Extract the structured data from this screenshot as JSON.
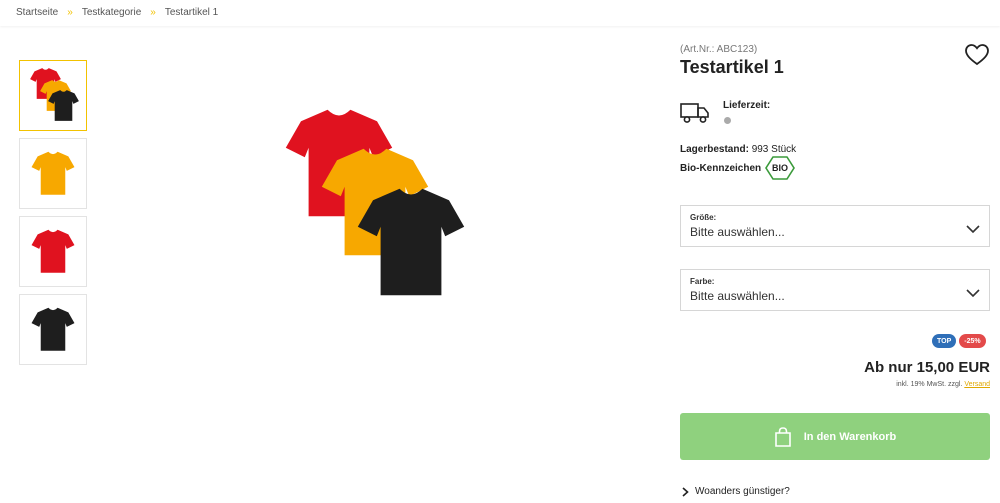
{
  "breadcrumb": {
    "items": [
      "Startseite",
      "Testkategorie",
      "Testartikel 1"
    ],
    "separator": "»"
  },
  "gallery": {
    "thumbnails": [
      "tshirt-set",
      "tshirt-yellow",
      "tshirt-red",
      "tshirt-black"
    ],
    "active_index": 0
  },
  "product": {
    "art_nr": "(Art.Nr.: ABC123)",
    "title": "Testartikel 1",
    "delivery_label": "Lieferzeit:",
    "stock_label": "Lagerbestand:",
    "stock_value": "993 Stück",
    "bio_label": "Bio-Kennzeichen",
    "bio_seal_text": "BIO"
  },
  "options": {
    "size": {
      "label": "Größe:",
      "placeholder": "Bitte auswählen..."
    },
    "color": {
      "label": "Farbe:",
      "placeholder": "Bitte auswählen..."
    }
  },
  "badges": {
    "top": "TOP",
    "sale": "-25%"
  },
  "pricing": {
    "price": "Ab nur 15,00 EUR",
    "tax_note": "inkl. 19% MwSt. zzgl.",
    "shipping_link": "Versand"
  },
  "actions": {
    "add_to_cart": "In den Warenkorb",
    "elsewhere": "Woanders günstiger?"
  },
  "colors": {
    "accent": "#f2c200",
    "cart_button": "#8fd17e",
    "badge_top": "#2f6fb8",
    "badge_sale": "#e34a4a",
    "shirt_red": "#e0121f",
    "shirt_yellow": "#f7a800",
    "shirt_black": "#1e1e1e"
  }
}
